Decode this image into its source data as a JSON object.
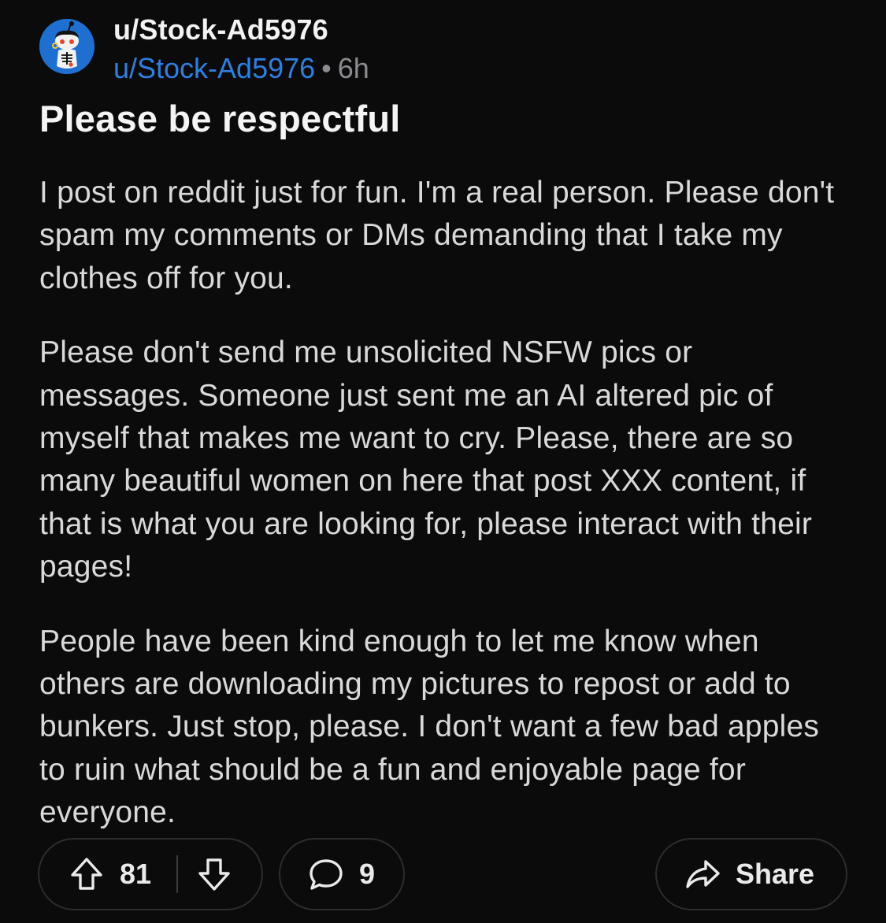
{
  "header": {
    "community": "u/Stock-Ad5976",
    "author": "u/Stock-Ad5976",
    "separator": "•",
    "time": "6h"
  },
  "post": {
    "title": "Please be respectful",
    "paragraphs": [
      "I post on reddit just for fun. I'm a real person. Please don't spam my comments or DMs demanding that I take my clothes off for you.",
      "Please don't send me unsolicited NSFW pics or messages. Someone just sent me an AI altered pic of myself that makes me want to cry. Please, there are so many beautiful women on here that post XXX content, if that is what you are looking for, please interact with their pages!",
      "People have been kind enough to let me know when others are downloading my pictures to repost or add to bunkers. Just stop, please. I don't want a few bad apples to ruin what should be a fun and enjoyable page for everyone."
    ]
  },
  "actions": {
    "upvote_count": "81",
    "comment_count": "9",
    "share_label": "Share"
  },
  "icons": {
    "avatar": "snoo-avatar-icon",
    "upvote": "arrow-up-icon",
    "downvote": "arrow-down-icon",
    "comment": "speech-bubble-icon",
    "share": "share-arrow-icon"
  },
  "colors": {
    "background": "#0b0b0b",
    "username_link": "#2e7fe0",
    "muted": "#8a8c90",
    "pill_border": "#2b2d30"
  }
}
